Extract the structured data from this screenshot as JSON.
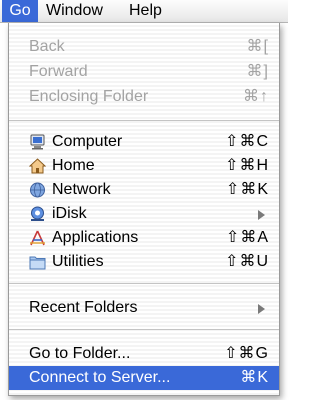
{
  "menubar": {
    "items": [
      {
        "label": "Go"
      },
      {
        "label": "Window"
      },
      {
        "label": "Help"
      }
    ]
  },
  "menu": {
    "group1": [
      {
        "label": "Back",
        "shortcut": "⌘[",
        "enabled": false
      },
      {
        "label": "Forward",
        "shortcut": "⌘]",
        "enabled": false
      },
      {
        "label": "Enclosing Folder",
        "shortcut": "⌘↑",
        "enabled": false
      }
    ],
    "group2": [
      {
        "label": "Computer",
        "shortcut": "⇧⌘C",
        "icon": "computer-icon"
      },
      {
        "label": "Home",
        "shortcut": "⇧⌘H",
        "icon": "home-icon"
      },
      {
        "label": "Network",
        "shortcut": "⇧⌘K",
        "icon": "network-icon"
      },
      {
        "label": "iDisk",
        "shortcut": "",
        "icon": "idisk-icon",
        "submenu": true
      },
      {
        "label": "Applications",
        "shortcut": "⇧⌘A",
        "icon": "applications-icon"
      },
      {
        "label": "Utilities",
        "shortcut": "⇧⌘U",
        "icon": "utilities-folder-icon"
      }
    ],
    "group3": [
      {
        "label": "Recent Folders",
        "submenu": true
      }
    ],
    "group4": [
      {
        "label": "Go to Folder...",
        "shortcut": "⇧⌘G"
      },
      {
        "label": "Connect to Server...",
        "shortcut": "⌘K",
        "highlighted": true
      }
    ]
  },
  "colors": {
    "accent": "#3a69d8",
    "disabled": "#a3a3a3"
  }
}
